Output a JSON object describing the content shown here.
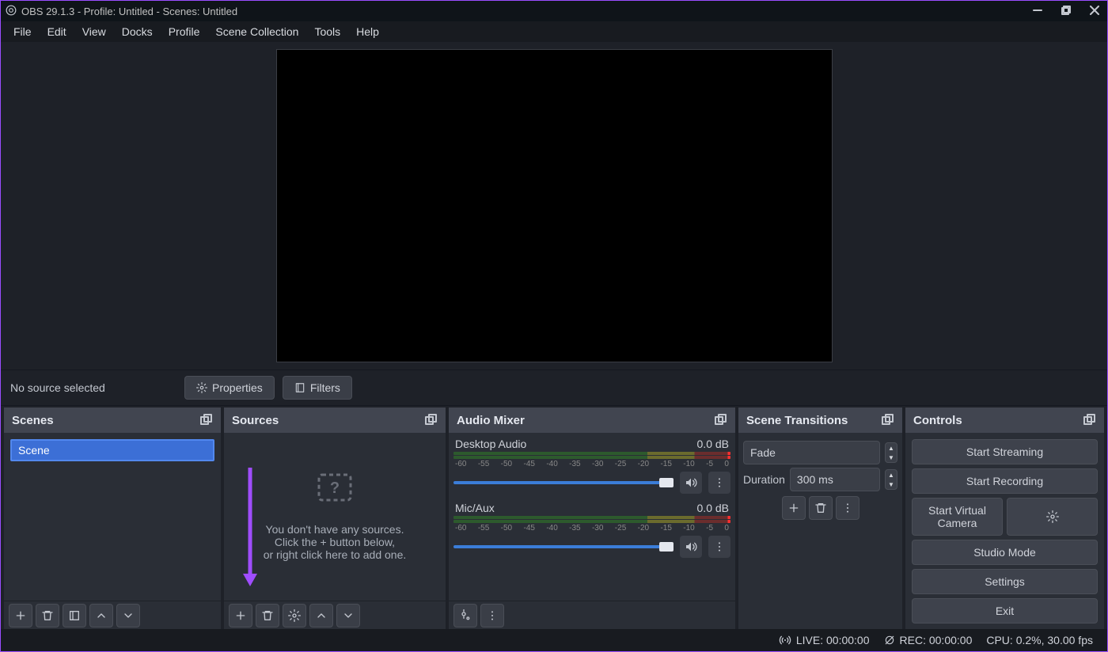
{
  "title": "OBS 29.1.3 - Profile: Untitled - Scenes: Untitled",
  "menu": [
    "File",
    "Edit",
    "View",
    "Docks",
    "Profile",
    "Scene Collection",
    "Tools",
    "Help"
  ],
  "source_toolbar": {
    "label": "No source selected",
    "properties": "Properties",
    "filters": "Filters"
  },
  "docks": {
    "scenes": {
      "title": "Scenes",
      "items": [
        "Scene"
      ]
    },
    "sources": {
      "title": "Sources",
      "empty_line1": "You don't have any sources.",
      "empty_line2": "Click the + button below,",
      "empty_line3": "or right click here to add one."
    },
    "mixer": {
      "title": "Audio Mixer",
      "channels": [
        {
          "name": "Desktop Audio",
          "db": "0.0 dB"
        },
        {
          "name": "Mic/Aux",
          "db": "0.0 dB"
        }
      ],
      "ticks": [
        "-60",
        "-55",
        "-50",
        "-45",
        "-40",
        "-35",
        "-30",
        "-25",
        "-20",
        "-15",
        "-10",
        "-5",
        "0"
      ]
    },
    "transitions": {
      "title": "Scene Transitions",
      "selected": "Fade",
      "duration_label": "Duration",
      "duration_value": "300 ms"
    },
    "controls": {
      "title": "Controls",
      "buttons": {
        "stream": "Start Streaming",
        "record": "Start Recording",
        "vcam": "Start Virtual Camera",
        "studio": "Studio Mode",
        "settings": "Settings",
        "exit": "Exit"
      }
    }
  },
  "status": {
    "live": "LIVE: 00:00:00",
    "rec": "REC: 00:00:00",
    "cpu": "CPU: 0.2%, 30.00 fps"
  }
}
